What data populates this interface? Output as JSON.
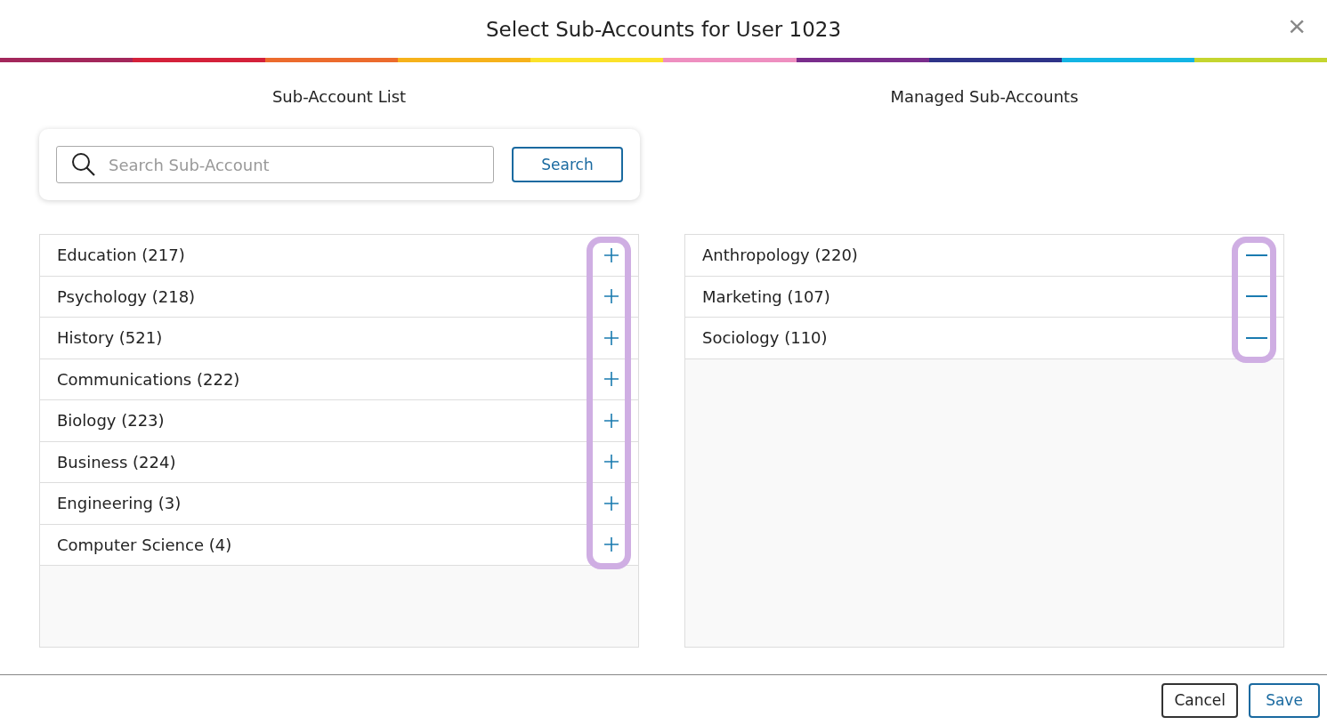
{
  "dialog": {
    "title": "Select Sub-Accounts for User 1023",
    "close": "×"
  },
  "available": {
    "heading": "Sub-Account List",
    "search": {
      "placeholder": "Search Sub-Account",
      "button": "Search"
    },
    "items": [
      {
        "label": "Education (217)"
      },
      {
        "label": "Psychology (218)"
      },
      {
        "label": "History (521)"
      },
      {
        "label": "Communications (222)"
      },
      {
        "label": "Biology (223)"
      },
      {
        "label": "Business (224)"
      },
      {
        "label": "Engineering (3)"
      },
      {
        "label": "Computer Science (4)"
      }
    ],
    "highlighted": true
  },
  "managed": {
    "heading": "Managed Sub-Accounts",
    "items": [
      {
        "label": "Anthropology (220)"
      },
      {
        "label": "Marketing (107)"
      },
      {
        "label": "Sociology (110)"
      }
    ],
    "highlighted": true
  },
  "buttons": [
    {
      "label": "Cancel",
      "kind": "secondary"
    },
    {
      "label": "Save",
      "kind": "primary"
    }
  ]
}
